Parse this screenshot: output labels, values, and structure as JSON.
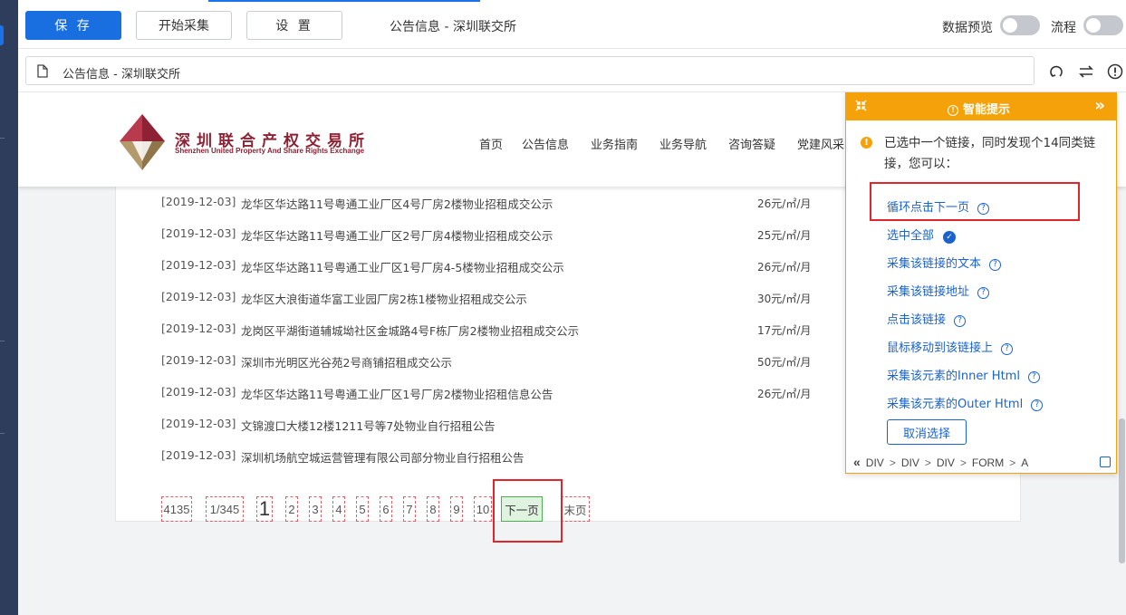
{
  "toolbar": {
    "save_label": "保 存",
    "start_label": "开始采集",
    "settings_label": "设 置",
    "page_title": "公告信息 - 深圳联交所",
    "data_preview_label": "数据预览",
    "flow_label": "流程"
  },
  "urlbar": {
    "text": "公告信息 - 深圳联交所"
  },
  "site": {
    "logo_cn": "深圳联合产权交易所",
    "logo_en": "Shenzhen United Property And Share Rights Exchange",
    "nav": [
      "首页",
      "公告信息",
      "业务指南",
      "业务导航",
      "咨询答疑",
      "党建风采"
    ],
    "rows": [
      {
        "date": "[2019-12-03]",
        "title": "龙华区华达路11号粤通工业厂区4号厂房2楼物业招租成交公示",
        "price": "26元/㎡/月"
      },
      {
        "date": "[2019-12-03]",
        "title": "龙华区华达路11号粤通工业厂区2号厂房4楼物业招租成交公示",
        "price": "25元/㎡/月"
      },
      {
        "date": "[2019-12-03]",
        "title": "龙华区华达路11号粤通工业厂区1号厂房4-5楼物业招租成交公示",
        "price": "26元/㎡/月"
      },
      {
        "date": "[2019-12-03]",
        "title": "龙华区大浪街道华富工业园厂房2栋1楼物业招租成交公示",
        "price": "30元/㎡/月"
      },
      {
        "date": "[2019-12-03]",
        "title": "龙岗区平湖街道辅城坳社区金城路4号F栋厂房2楼物业招租成交公示",
        "price": "17元/㎡/月"
      },
      {
        "date": "[2019-12-03]",
        "title": "深圳市光明区光谷苑2号商铺招租成交公示",
        "price": "50元/㎡/月"
      },
      {
        "date": "[2019-12-03]",
        "title": "龙华区华达路11号粤通工业厂区1号厂房2楼物业招租信息公告",
        "price": "26元/㎡/月"
      },
      {
        "date": "[2019-12-03]",
        "title": "文锦渡口大楼12楼1211号等7处物业自行招租公告",
        "price": ""
      },
      {
        "date": "[2019-12-03]",
        "title": "深圳机场航空城运营管理有限公司部分物业自行招租公告",
        "price": ""
      }
    ],
    "pager": {
      "total": "4135",
      "page_of": "1/345",
      "current": "1",
      "pages": [
        "2",
        "3",
        "4",
        "5",
        "6",
        "7",
        "8",
        "9",
        "10"
      ],
      "next": "下一页",
      "last": "末页"
    }
  },
  "panel": {
    "title": "智能提示",
    "message": "已选中一个链接，同时发现个14同类链接，您可以：",
    "actions": [
      {
        "label": "循环点击下一页",
        "help": true
      },
      {
        "label": "选中全部",
        "check": true
      },
      {
        "label": "采集该链接的文本",
        "help": true
      },
      {
        "label": "采集该链接地址",
        "help": true
      },
      {
        "label": "点击该链接",
        "help": true
      },
      {
        "label": "鼠标移动到该链接上",
        "help": true
      },
      {
        "label": "采集该元素的Inner Html",
        "help": true
      },
      {
        "label": "采集该元素的Outer Html",
        "help": true
      }
    ],
    "cancel_label": "取消选择",
    "crumbs": [
      "DIV",
      "DIV",
      "DIV",
      "FORM",
      "A"
    ]
  },
  "colors": {
    "primary": "#1a6fe0",
    "panel_accent": "#f5a20a",
    "highlight_red": "#e0262b",
    "brand": "#8c2233"
  }
}
